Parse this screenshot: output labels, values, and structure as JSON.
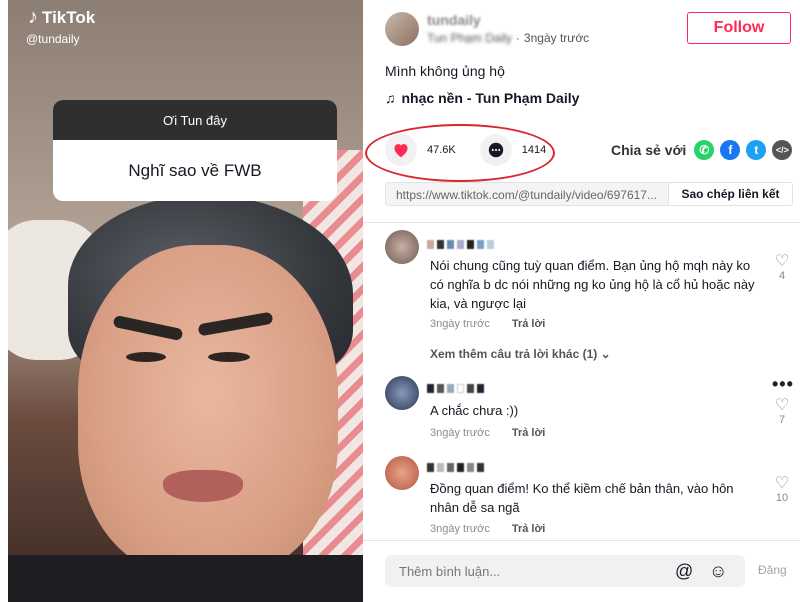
{
  "brand": {
    "name": "TikTok",
    "handle": "@tundaily"
  },
  "question_box": {
    "header": "Ơi Tun đây",
    "question": "Nghĩ sao về FWB"
  },
  "post": {
    "username": "tundaily",
    "display_name": "Tun Phạm Daily",
    "time": "3ngày trước",
    "follow_label": "Follow",
    "caption": "Mình không ủng hộ",
    "music": "nhạc nền - Tun Phạm Daily",
    "likes": "47.6K",
    "comments": "1414",
    "share_label": "Chia sẻ với",
    "link": "https://www.tiktok.com/@tundaily/video/697617...",
    "copy_label": "Sao chép liên kết"
  },
  "comments": [
    {
      "text": "Nói chung cũng tuỳ quan điểm. Bạn ủng hộ mqh này ko có nghĩa b dc nói những ng ko ủng hộ là cổ hủ hoặc này kia, và ngược lại",
      "time": "3ngày trước",
      "reply": "Trả lời",
      "likes": "4"
    },
    {
      "text": "A chắc chưa :))",
      "time": "3ngày trước",
      "reply": "Trả lời",
      "likes": "7"
    },
    {
      "text": "Đồng quan điểm! Ko thể kiềm chế bản thân, vào hôn nhân dễ sa ngã",
      "time": "3ngày trước",
      "reply": "Trả lời",
      "likes": "10"
    }
  ],
  "more_replies": "Xem thêm câu trả lời khác (1)",
  "composer": {
    "placeholder": "Thêm bình luận...",
    "post_label": "Đăng"
  },
  "colors": {
    "accent": "#fe2c55",
    "annotation_circle": "#d7262e",
    "whatsapp": "#25d366",
    "facebook": "#1877f2",
    "twitter": "#1da1f2",
    "embed": "#555555"
  },
  "icons": [
    "tiktok-logo-icon",
    "music-note-icon",
    "heart-icon",
    "comment-icon",
    "whatsapp-icon",
    "facebook-icon",
    "twitter-icon",
    "embed-icon",
    "like-heart-icon",
    "more-dots-icon",
    "chevron-down-icon",
    "at-mention-icon",
    "emoji-icon"
  ]
}
